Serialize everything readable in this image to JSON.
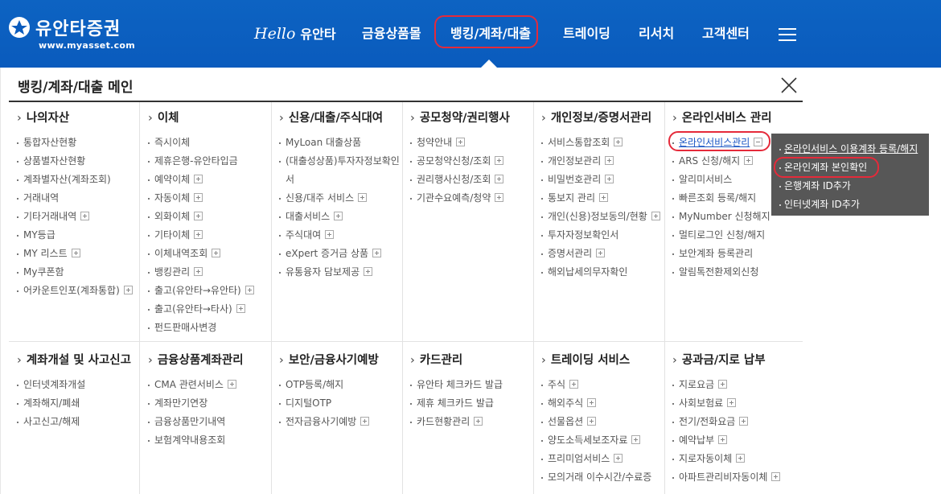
{
  "header": {
    "logo_text": "유안타증권",
    "logo_url": "www.myasset.com",
    "nav": [
      {
        "prefix": "Hello",
        "label": "유안타"
      },
      {
        "prefix": "",
        "label": "금융상품몰"
      },
      {
        "prefix": "",
        "label": "뱅킹/계좌/대출"
      },
      {
        "prefix": "",
        "label": "트레이딩"
      },
      {
        "prefix": "",
        "label": "리서치"
      },
      {
        "prefix": "",
        "label": "고객센터"
      }
    ],
    "menu_icon": "hamburger-icon",
    "colors": {
      "header_bg": "#0a5bbd",
      "highlight": "#e52a3a"
    }
  },
  "panel": {
    "title": "뱅킹/계좌/대출 메인",
    "close_icon": "close-icon",
    "columns_row1": [
      {
        "title": "나의자산",
        "items": [
          "통합자산현황",
          "상품별자산현황",
          "계좌별자산(계좌조회)",
          "거래내역",
          "기타거래내역",
          "MY등급",
          "MY 리스트",
          "My쿠폰함",
          "어카운트인포(계좌통합)"
        ]
      },
      {
        "title": "이체",
        "items": [
          "즉시이체",
          "제휴은행-유안타입금",
          "예약이체",
          "자동이체",
          "외화이체",
          "기타이체",
          "이체내역조회",
          "뱅킹관리",
          "출고(유안타→유안타)",
          "출고(유안타→타사)",
          "펀드판매사변경"
        ]
      },
      {
        "title": "신용/대출/주식대여",
        "items": [
          "MyLoan 대출상품",
          "(대출성상품)투자자정보확인서",
          "신용/대주 서비스",
          "대출서비스",
          "주식대여",
          "eXpert 증거금 상품",
          "유통융자 담보제공"
        ]
      },
      {
        "title": "공모청약/권리행사",
        "items": [
          "청약안내",
          "공모청약신청/조회",
          "권리행사신청/조회",
          "기관수요예측/청약"
        ]
      },
      {
        "title": "개인정보/증명서관리",
        "items": [
          "서비스통합조회",
          "개인정보관리",
          "비밀번호관리",
          "통보지 관리",
          "개인(신용)정보동의/현황",
          "투자자정보확인서",
          "증명서관리",
          "해외납세의무자확인"
        ]
      },
      {
        "title": "온라인서비스 관리",
        "items": [
          "온라인서비스관리",
          "ARS 신청/해지",
          "알리미서비스",
          "빠른조회 등록/해지",
          "MyNumber 신청해지",
          "멀티로그인 신청/해지",
          "보안계좌 등록관리",
          "알림톡전환제외신청"
        ]
      }
    ],
    "columns_row2": [
      {
        "title": "계좌개설 및 사고신고",
        "items": [
          "인터넷계좌개설",
          "계좌해지/폐쇄",
          "사고신고/해제"
        ]
      },
      {
        "title": "금융상품계좌관리",
        "items": [
          "CMA 관련서비스",
          "계좌만기연장",
          "금융상품만기내역",
          "보험계약내용조회"
        ]
      },
      {
        "title": "보안/금융사기예방",
        "items": [
          "OTP등록/해지",
          "디지털OTP",
          "전자금융사기예방"
        ]
      },
      {
        "title": "카드관리",
        "items": [
          "유안타 체크카드 발급",
          "제휴 체크카드 발급",
          "카드현황관리"
        ]
      },
      {
        "title": "트레이딩 서비스",
        "items": [
          "주식",
          "해외주식",
          "선물옵션",
          "양도소득세보조자료",
          "프리미엄서비스",
          "모의거래 이수시간/수료증"
        ]
      },
      {
        "title": "공과금/지로 납부",
        "items": [
          "지로요금",
          "사회보험료",
          "전기/전화요금",
          "예약납부",
          "지로자동이체",
          "아파트관리비자동이체"
        ]
      }
    ],
    "submenu": {
      "items": [
        "온라인서비스 이용계좌 등록/해지",
        "온라인계좌 본인확인",
        "은행계좌 ID추가",
        "인터넷계좌 ID추가"
      ]
    }
  }
}
